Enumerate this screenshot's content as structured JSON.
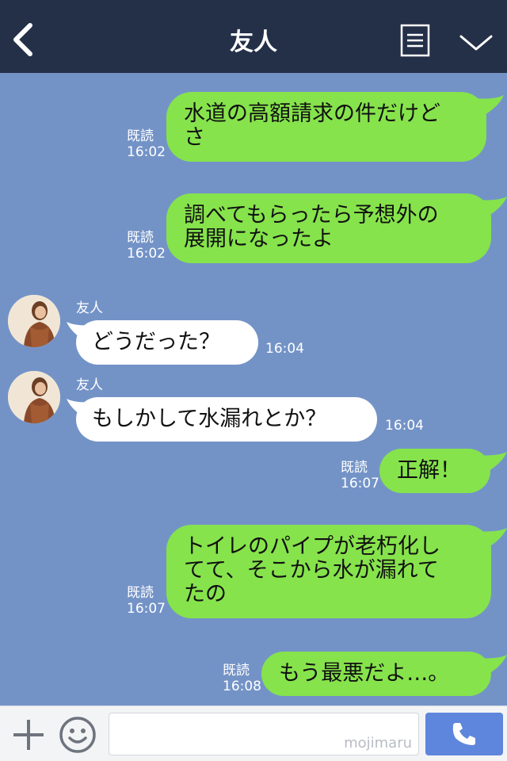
{
  "header": {
    "title": "友人",
    "back_icon": "chevron-left-icon",
    "menu_icon": "notes-icon",
    "collapse_icon": "chevron-down-icon"
  },
  "messages": [
    {
      "side": "me",
      "text_lines": [
        "水道の高額請求の件だけど",
        "さ"
      ],
      "read": "既読",
      "time": "16:02"
    },
    {
      "side": "me",
      "text_lines": [
        "調べてもらったら予想外の",
        "展開になったよ"
      ],
      "read": "既読",
      "time": "16:02"
    },
    {
      "side": "them",
      "sender": "友人",
      "text": "どうだった？",
      "time": "16:04"
    },
    {
      "side": "them",
      "sender": "友人",
      "text": "もしかして水漏れとか？",
      "time": "16:04"
    },
    {
      "side": "me",
      "text_lines": [
        "正解！"
      ],
      "read": "既読",
      "time": "16:07"
    },
    {
      "side": "me",
      "text_lines": [
        "トイレのパイプが老朽化し",
        "てて、そこから水が漏れて",
        "たの"
      ],
      "read": "既読",
      "time": "16:07"
    },
    {
      "side": "me",
      "text_lines": [
        "もう最悪だよ…。"
      ],
      "read": "既読",
      "time": "16:08"
    }
  ],
  "footer": {
    "input_placeholder": "",
    "watermark": "mojimaru",
    "plus_icon": "plus-icon",
    "emoji_icon": "smiley-icon",
    "send_icon": "phone-icon"
  },
  "colors": {
    "header_bg": "#243048",
    "chat_bg": "#7393c7",
    "my_bubble": "#86e34c",
    "their_bubble": "#ffffff",
    "send_button": "#5e86dc"
  }
}
